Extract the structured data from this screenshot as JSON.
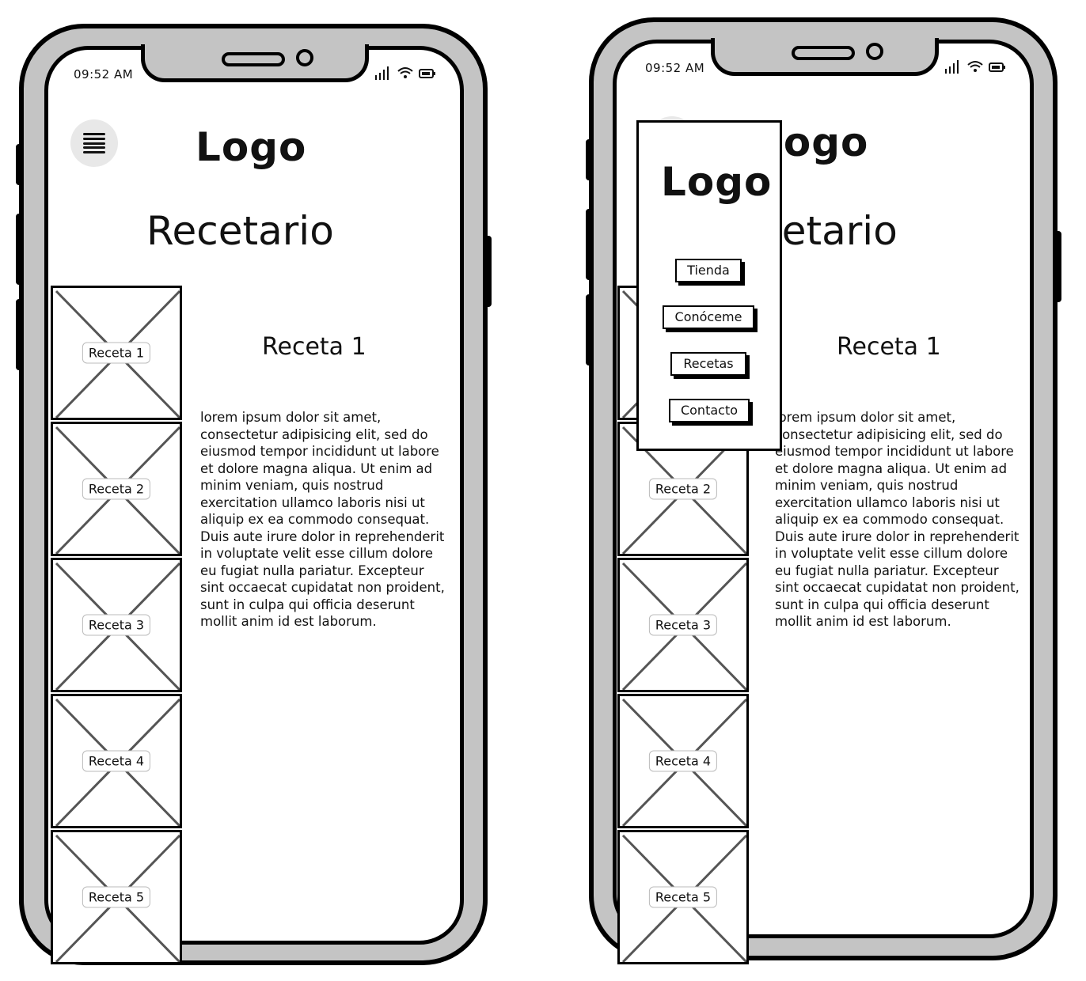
{
  "status": {
    "time": "09:52 AM"
  },
  "header": {
    "logo": "Logo",
    "menu_icon": "hamburger-menu-icon"
  },
  "page": {
    "title": "Recetario"
  },
  "recipe": {
    "title": "Receta 1",
    "body": "lorem ipsum dolor sit amet, consectetur adipisicing elit, sed do eiusmod tempor incididunt ut labore et dolore magna aliqua. Ut enim ad minim veniam, quis nostrud exercitation ullamco laboris nisi ut aliquip ex ea commodo consequat. Duis aute irure dolor in reprehenderit in voluptate velit esse cillum dolore eu fugiat nulla pariatur. Excepteur sint occaecat cupidatat non proident, sunt in culpa qui officia deserunt mollit anim id est laborum."
  },
  "recipes": [
    {
      "label": "Receta 1"
    },
    {
      "label": "Receta 2"
    },
    {
      "label": "Receta 3"
    },
    {
      "label": "Receta 4"
    },
    {
      "label": "Receta 5"
    }
  ],
  "drawer": {
    "logo": "Logo",
    "items": [
      {
        "label": "Tienda"
      },
      {
        "label": "Conóceme"
      },
      {
        "label": "Recetas"
      },
      {
        "label": "Contacto"
      }
    ]
  }
}
